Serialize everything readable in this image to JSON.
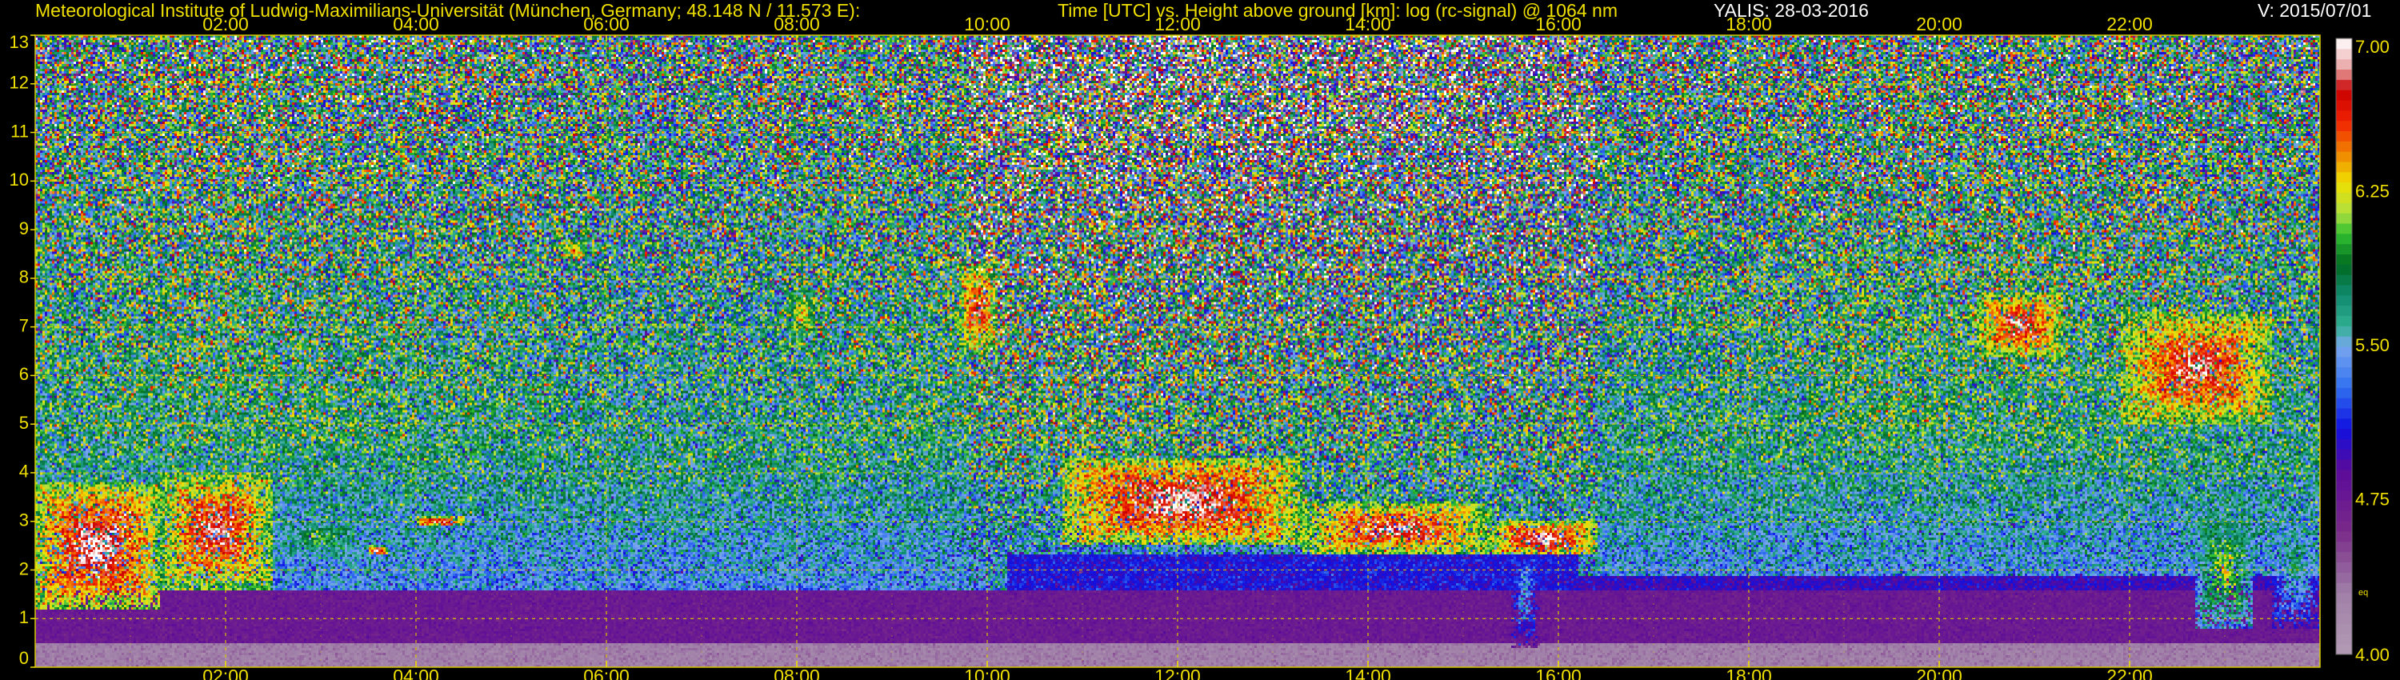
{
  "header": {
    "institute": "Meteorological Institute of Ludwig-Maximilians-Universität (München, Germany; 48.148 N / 11.573 E):",
    "description": "Time [UTC] vs. Height above ground [km]: log (rc-signal) @ 1064 nm",
    "instrument": "YALIS: 28-03-2016",
    "version": "V: 2015/07/01"
  },
  "colors": {
    "text_yellow": "#f0e000",
    "grid": "#d6c800",
    "background": "#000000"
  },
  "chart_data": {
    "type": "heatmap",
    "title": "Time [UTC] vs. Height above ground [km]: log (rc-signal) @ 1064 nm",
    "x_range_hours": [
      0,
      24
    ],
    "x_ticks": [
      {
        "hour": 2,
        "label": "02:00"
      },
      {
        "hour": 4,
        "label": "04:00"
      },
      {
        "hour": 6,
        "label": "06:00"
      },
      {
        "hour": 8,
        "label": "08:00"
      },
      {
        "hour": 10,
        "label": "10:00"
      },
      {
        "hour": 12,
        "label": "12:00"
      },
      {
        "hour": 14,
        "label": "14:00"
      },
      {
        "hour": 16,
        "label": "16:00"
      },
      {
        "hour": 18,
        "label": "18:00"
      },
      {
        "hour": 20,
        "label": "20:00"
      },
      {
        "hour": 22,
        "label": "22:00"
      }
    ],
    "ylim": [
      0,
      13
    ],
    "y_ticks": [
      "0",
      "1",
      "2",
      "3",
      "4",
      "5",
      "6",
      "7",
      "8",
      "9",
      "10",
      "11",
      "12",
      "13"
    ],
    "grid": true,
    "grid_style": "dashed",
    "colorbar": {
      "range": [
        4.0,
        7.0
      ],
      "labels": [
        "7.00",
        "6.25",
        "5.50",
        "4.75",
        "4.00"
      ],
      "eq_label": "eq",
      "stops": [
        {
          "value": 4.0,
          "color": "#b49bb4"
        },
        {
          "value": 4.3,
          "color": "#a080a8"
        },
        {
          "value": 4.6,
          "color": "#7a2a88"
        },
        {
          "value": 4.9,
          "color": "#5a0a9a"
        },
        {
          "value": 5.1,
          "color": "#1010e0"
        },
        {
          "value": 5.3,
          "color": "#3070f0"
        },
        {
          "value": 5.5,
          "color": "#7aa6f0"
        },
        {
          "value": 5.6,
          "color": "#30b090"
        },
        {
          "value": 5.75,
          "color": "#108a70"
        },
        {
          "value": 5.9,
          "color": "#006a20"
        },
        {
          "value": 6.05,
          "color": "#30c030"
        },
        {
          "value": 6.15,
          "color": "#b0e040"
        },
        {
          "value": 6.3,
          "color": "#f0e000"
        },
        {
          "value": 6.45,
          "color": "#f08000"
        },
        {
          "value": 6.6,
          "color": "#f02000"
        },
        {
          "value": 6.75,
          "color": "#c80000"
        },
        {
          "value": 6.85,
          "color": "#e8a0a0"
        },
        {
          "value": 7.0,
          "color": "#ffffff"
        }
      ]
    },
    "regions": [
      {
        "type": "surface",
        "t0": 0,
        "t1": 24,
        "h0": 0,
        "h1": 0.6,
        "v": 4.3
      },
      {
        "type": "surface",
        "t0": 0,
        "t1": 24,
        "h0": 0.5,
        "h1": 1.6,
        "v": 4.75
      },
      {
        "type": "layer",
        "t0": 0,
        "t1": 10.2,
        "h0": 0.6,
        "h1": 1.4,
        "v": 5.15
      },
      {
        "type": "layer",
        "t0": 10.2,
        "t1": 16.2,
        "h0": 0.5,
        "h1": 2.3,
        "v": 5.1
      },
      {
        "type": "layer",
        "t0": 16.2,
        "t1": 24,
        "h0": 0.6,
        "h1": 1.9,
        "v": 5.0
      },
      {
        "type": "cloud",
        "t0": 0.0,
        "t1": 1.3,
        "h0": 1.2,
        "h1": 3.8,
        "v": 7.0
      },
      {
        "type": "cloud",
        "t0": 1.3,
        "t1": 2.5,
        "h0": 1.6,
        "h1": 4.0,
        "v": 6.9
      },
      {
        "type": "cloud",
        "t0": 2.5,
        "t1": 3.5,
        "h0": 2.2,
        "h1": 3.1,
        "v": 6.1
      },
      {
        "type": "cloud",
        "t0": 3.5,
        "t1": 3.7,
        "h0": 2.3,
        "h1": 2.5,
        "v": 7.0
      },
      {
        "type": "cloud",
        "t0": 4.0,
        "t1": 4.5,
        "h0": 2.9,
        "h1": 3.1,
        "v": 7.0
      },
      {
        "type": "cloud",
        "t0": 5.5,
        "t1": 5.8,
        "h0": 8.4,
        "h1": 8.8,
        "v": 6.6
      },
      {
        "type": "cloud",
        "t0": 7.9,
        "t1": 8.2,
        "h0": 6.8,
        "h1": 7.7,
        "v": 6.5
      },
      {
        "type": "cloud",
        "t0": 9.7,
        "t1": 10.1,
        "h0": 6.5,
        "h1": 8.3,
        "v": 6.8
      },
      {
        "type": "cloud",
        "t0": 10.8,
        "t1": 13.3,
        "h0": 2.5,
        "h1": 4.3,
        "v": 7.0
      },
      {
        "type": "cloud",
        "t0": 13.3,
        "t1": 15.3,
        "h0": 2.3,
        "h1": 3.4,
        "v": 6.9
      },
      {
        "type": "cloud",
        "t0": 15.3,
        "t1": 16.4,
        "h0": 2.3,
        "h1": 3.0,
        "v": 7.0
      },
      {
        "type": "cloud",
        "t0": 15.5,
        "t1": 15.8,
        "h0": 0.4,
        "h1": 2.6,
        "v": 5.6
      },
      {
        "type": "cloud",
        "t0": 20.4,
        "t1": 21.3,
        "h0": 6.4,
        "h1": 7.7,
        "v": 6.9
      },
      {
        "type": "cloud",
        "t0": 21.9,
        "t1": 23.5,
        "h0": 5.0,
        "h1": 7.3,
        "v": 6.9
      },
      {
        "type": "cloud",
        "t0": 22.7,
        "t1": 23.3,
        "h0": 0.8,
        "h1": 3.2,
        "v": 6.3
      },
      {
        "type": "cloud",
        "t0": 23.5,
        "t1": 24.0,
        "h0": 0.8,
        "h1": 3.5,
        "v": 5.8
      }
    ]
  }
}
